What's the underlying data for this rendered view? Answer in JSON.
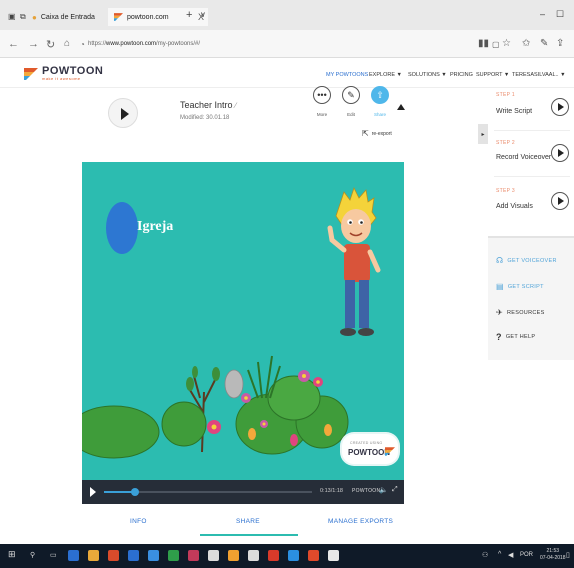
{
  "browser": {
    "tabs": [
      {
        "label": "Caixa de Entrada"
      },
      {
        "label": "powtoon.com"
      }
    ],
    "new_tab_glyph": "+",
    "tab_list_glyph": "∨",
    "close_glyph": "X",
    "url_prefix": "https://",
    "url_domain": "www.powtoon.com",
    "url_path": "/my-powtoons/#/",
    "window_min": "–",
    "window_max": "☐"
  },
  "header": {
    "logo_text": "POWTOON",
    "logo_tagline": "make it awesome",
    "menu": [
      {
        "label": "MY POWTOONS"
      },
      {
        "label": "EXPLORE ▼"
      },
      {
        "label": "SOLUTIONS ▼"
      },
      {
        "label": "PRICING"
      },
      {
        "label": "SUPPORT ▼"
      },
      {
        "label": "TERESASILVAAL.. ▼"
      }
    ]
  },
  "toolbar": {
    "title": "Teacher Intro",
    "modified": "Modified: 30.01.18",
    "more_label": "More",
    "edit_label": "Edit",
    "share_label": "Share",
    "reexport_label": "re-export"
  },
  "stage": {
    "slide_text": "Igreja",
    "badge_small": "CREATED USING",
    "badge_big": "POWTOON"
  },
  "player": {
    "progress": 0.15,
    "timecode": "0:13/1:18",
    "brand": "POWTOON"
  },
  "bottom_tabs": [
    {
      "label": "INFO"
    },
    {
      "label": "SHARE"
    },
    {
      "label": "MANAGE EXPORTS"
    }
  ],
  "steps": [
    {
      "num": "STEP 1",
      "title": "Write Script"
    },
    {
      "num": "STEP 2",
      "title": "Record Voiceover"
    },
    {
      "num": "STEP 3",
      "title": "Add Visuals"
    }
  ],
  "tools": [
    {
      "label": "GET VOICEOVER"
    },
    {
      "label": "GET SCRIPT"
    },
    {
      "label": "RESOURCES"
    },
    {
      "label": "GET HELP"
    }
  ],
  "taskbar": {
    "lang": "POR",
    "time": "21:53",
    "date": "07-04-2018"
  },
  "colors": {
    "stage_bg": "#2cbcb0",
    "accent_blue": "#2a6fcf",
    "step_orange": "#ea8a6a"
  }
}
